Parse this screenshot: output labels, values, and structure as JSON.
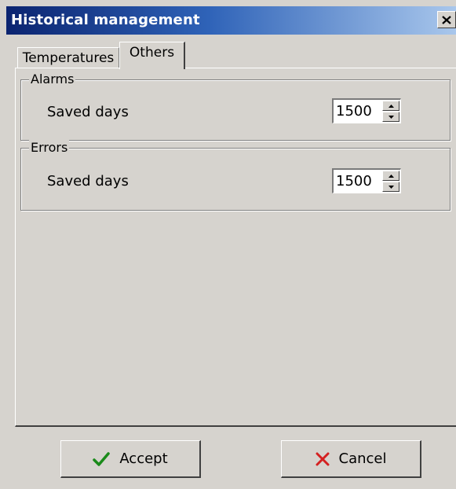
{
  "window": {
    "title": "Historical management",
    "close_icon": "close-icon"
  },
  "tabs": [
    {
      "label": "Temperatures",
      "selected": false
    },
    {
      "label": "Others",
      "selected": true
    }
  ],
  "groups": {
    "alarms": {
      "title": "Alarms",
      "field_label": "Saved days",
      "value": "1500"
    },
    "errors": {
      "title": "Errors",
      "field_label": "Saved days",
      "value": "1500"
    }
  },
  "buttons": {
    "accept": {
      "label": "Accept",
      "icon": "checkmark-icon",
      "icon_color": "#1a8a1a"
    },
    "cancel": {
      "label": "Cancel",
      "icon": "x-icon",
      "icon_color": "#d42020"
    }
  },
  "colors": {
    "titlebar_start": "#0b2470",
    "titlebar_end": "#a9c7ec",
    "dialog_face": "#d6d3ce"
  }
}
